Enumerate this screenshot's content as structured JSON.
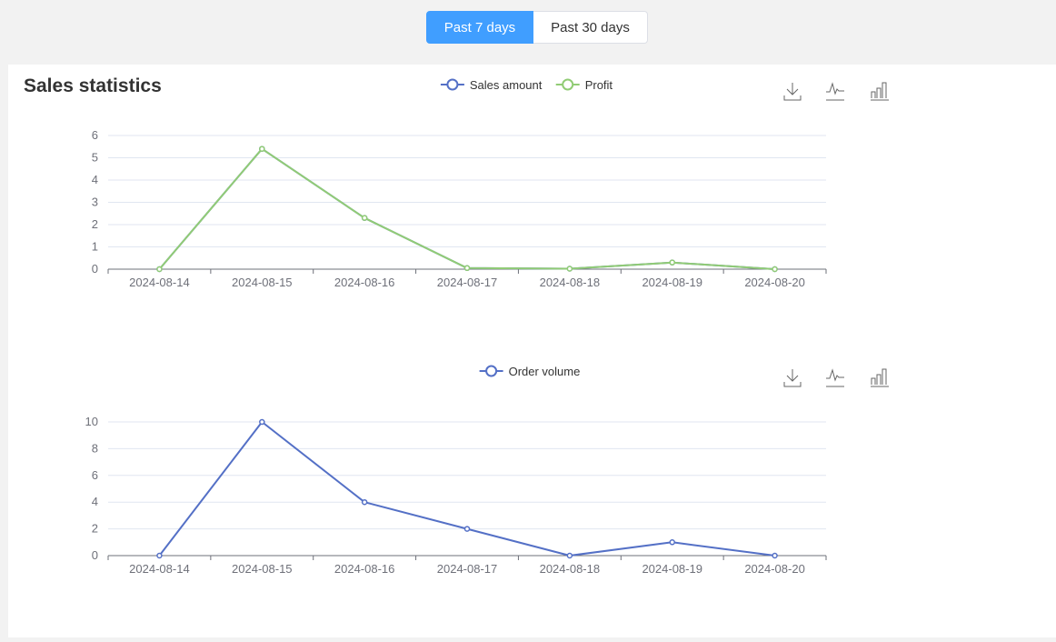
{
  "filter": {
    "options": [
      "Past 7 days",
      "Past 30 days"
    ],
    "selected": "Past 7 days"
  },
  "panel": {
    "title": "Sales statistics"
  },
  "toolbox": {
    "icons": [
      "download-icon",
      "line-chart-icon",
      "bar-chart-icon"
    ]
  },
  "colors": {
    "sales": "#5470c6",
    "profit": "#91cc75",
    "accent": "#409eff"
  },
  "chart_data": [
    {
      "type": "line",
      "legend_position": "top-center",
      "categories": [
        "2024-08-14",
        "2024-08-15",
        "2024-08-16",
        "2024-08-17",
        "2024-08-18",
        "2024-08-19",
        "2024-08-20"
      ],
      "series": [
        {
          "name": "Sales amount",
          "color": "#5470c6",
          "values": [
            0,
            5.4,
            2.3,
            0.05,
            0.02,
            0.3,
            0
          ]
        },
        {
          "name": "Profit",
          "color": "#91cc75",
          "values": [
            0,
            5.4,
            2.3,
            0.05,
            0.02,
            0.3,
            0
          ]
        }
      ],
      "ylim": [
        0,
        6
      ],
      "yticks": [
        0,
        1,
        2,
        3,
        4,
        5,
        6
      ],
      "grid": true
    },
    {
      "type": "line",
      "legend_position": "top-center",
      "categories": [
        "2024-08-14",
        "2024-08-15",
        "2024-08-16",
        "2024-08-17",
        "2024-08-18",
        "2024-08-19",
        "2024-08-20"
      ],
      "series": [
        {
          "name": "Order volume",
          "color": "#5470c6",
          "values": [
            0,
            10,
            4,
            2,
            0,
            1,
            0
          ]
        }
      ],
      "ylim": [
        0,
        10
      ],
      "yticks": [
        0,
        2,
        4,
        6,
        8,
        10
      ],
      "grid": true
    }
  ]
}
